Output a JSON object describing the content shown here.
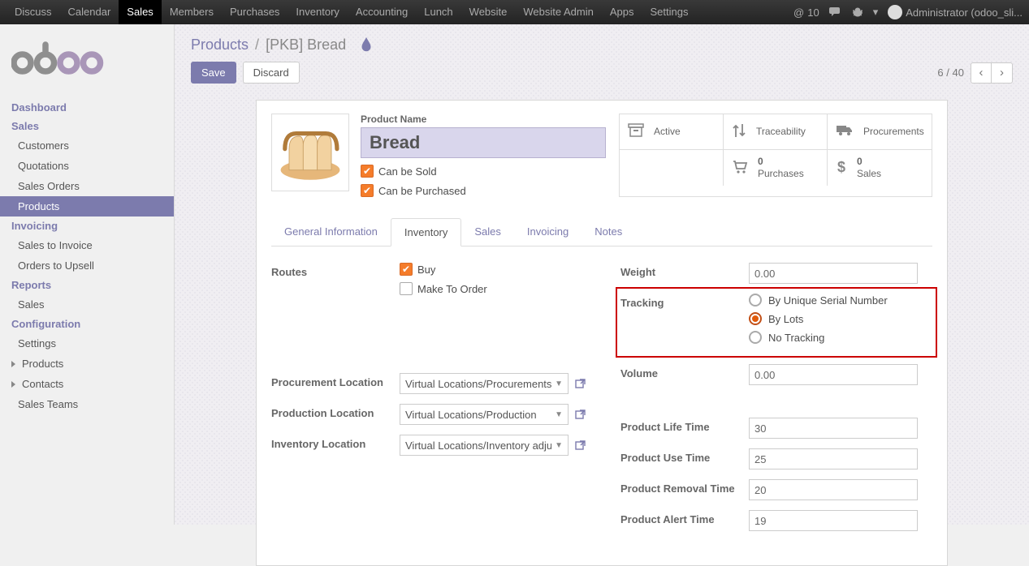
{
  "topMenu": [
    "Discuss",
    "Calendar",
    "Sales",
    "Members",
    "Purchases",
    "Inventory",
    "Accounting",
    "Lunch",
    "Website",
    "Website Admin",
    "Apps",
    "Settings"
  ],
  "topMenuActive": "Sales",
  "noticeCount": "10",
  "userLabel": "Administrator (odoo_sli...",
  "sidebar": {
    "dashboard": "Dashboard",
    "sales": "Sales",
    "salesItems": [
      "Customers",
      "Quotations",
      "Sales Orders",
      "Products"
    ],
    "salesActive": "Products",
    "invoicing": "Invoicing",
    "invoicingItems": [
      "Sales to Invoice",
      "Orders to Upsell"
    ],
    "reports": "Reports",
    "reportsItems": [
      "Sales"
    ],
    "config": "Configuration",
    "configItems": [
      "Settings",
      "Products",
      "Contacts",
      "Sales Teams"
    ]
  },
  "breadcrumb": {
    "root": "Products",
    "sep": "/",
    "current": "[PKB] Bread"
  },
  "actions": {
    "save": "Save",
    "discard": "Discard"
  },
  "pager": {
    "pos": "6",
    "sep": "/",
    "total": "40"
  },
  "product": {
    "nameLabel": "Product Name",
    "name": "Bread",
    "canSold": "Can be Sold",
    "canPurchased": "Can be Purchased"
  },
  "stats": {
    "active": "Active",
    "trace": "Traceability",
    "proc": "Procurements",
    "purchN": "0",
    "purch": "Purchases",
    "salesN": "0",
    "sales": "Sales"
  },
  "tabs": [
    "General Information",
    "Inventory",
    "Sales",
    "Invoicing",
    "Notes"
  ],
  "tabActive": "Inventory",
  "inv": {
    "routesLbl": "Routes",
    "buy": "Buy",
    "mto": "Make To Order",
    "procLocLbl": "Procurement Location",
    "procLoc": "Virtual Locations/Procurements",
    "prodLocLbl": "Production Location",
    "prodLoc": "Virtual Locations/Production",
    "invLocLbl": "Inventory Location",
    "invLoc": "Virtual Locations/Inventory adjustr",
    "weightLbl": "Weight",
    "weight": "0.00",
    "trackLbl": "Tracking",
    "trackOpts": [
      "By Unique Serial Number",
      "By Lots",
      "No Tracking"
    ],
    "trackSel": "By Lots",
    "volumeLbl": "Volume",
    "volume": "0.00",
    "lifeLbl": "Product Life Time",
    "life": "30",
    "useLbl": "Product Use Time",
    "use": "25",
    "remLbl": "Product Removal Time",
    "rem": "20",
    "alertLbl": "Product Alert Time",
    "alert": "19"
  }
}
